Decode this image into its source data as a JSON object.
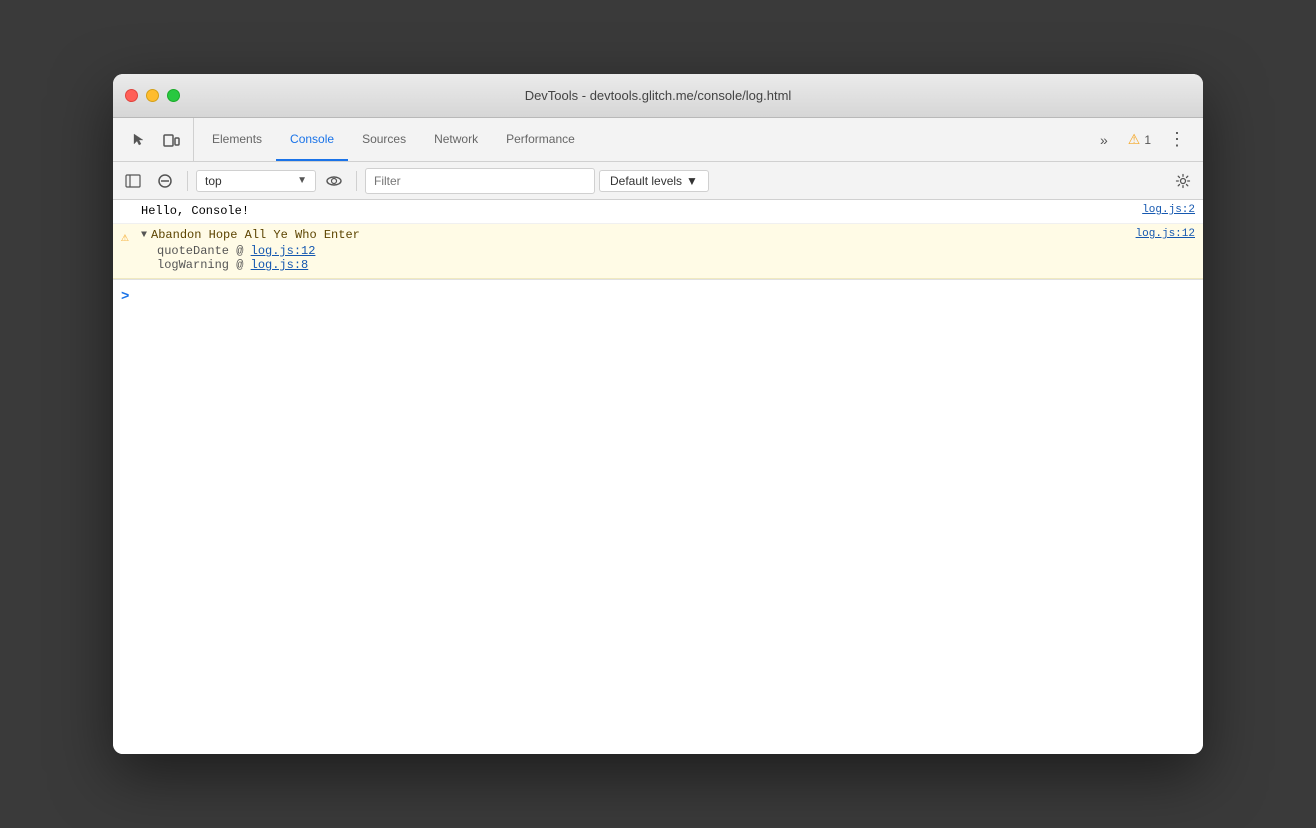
{
  "window": {
    "title": "DevTools - devtools.glitch.me/console/log.html"
  },
  "tabs": {
    "items": [
      {
        "id": "elements",
        "label": "Elements",
        "active": false
      },
      {
        "id": "console",
        "label": "Console",
        "active": true
      },
      {
        "id": "sources",
        "label": "Sources",
        "active": false
      },
      {
        "id": "network",
        "label": "Network",
        "active": false
      },
      {
        "id": "performance",
        "label": "Performance",
        "active": false
      }
    ],
    "more_label": "»",
    "warning_count": "1",
    "menu_icon": "⋮"
  },
  "console_toolbar": {
    "context_value": "top",
    "filter_placeholder": "Filter",
    "levels_label": "Default levels",
    "levels_arrow": "▼"
  },
  "console_output": {
    "rows": [
      {
        "type": "log",
        "message": "Hello, Console!",
        "source": "log.js:2"
      },
      {
        "type": "warning",
        "expanded": true,
        "message": "Abandon Hope All Ye Who Enter",
        "source": "log.js:12",
        "stack": [
          {
            "text": "quoteDante @ ",
            "link": "log.js:12"
          },
          {
            "text": "logWarning @ ",
            "link": "log.js:8"
          }
        ]
      }
    ],
    "input_prompt": ">"
  }
}
